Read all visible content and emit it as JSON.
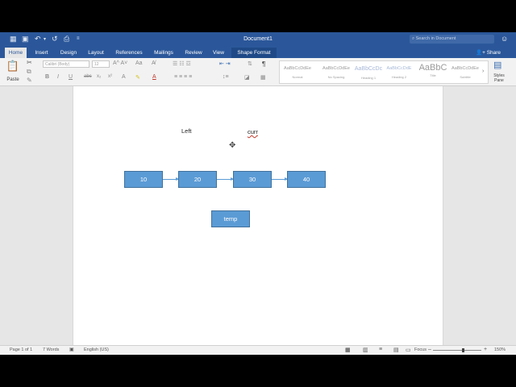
{
  "window": {
    "title": "Document1",
    "search_placeholder": "Search in Document",
    "qat": [
      "grid-icon",
      "save-icon",
      "undo-icon",
      "redo-icon",
      "print-icon",
      "customize-icon"
    ]
  },
  "tabs": [
    "Home",
    "Insert",
    "Design",
    "Layout",
    "References",
    "Mailings",
    "Review",
    "View",
    "Shape Format"
  ],
  "active_tab": "Home",
  "share_label": "Share",
  "ribbon": {
    "paste_label": "Paste",
    "font_name": "Calibri (Body)",
    "font_size": "12",
    "styles": [
      {
        "sample": "AaBbCcDdEe",
        "name": "Normal"
      },
      {
        "sample": "AaBbCcDdEe",
        "name": "No Spacing"
      },
      {
        "sample": "AaBbCcDc",
        "name": "Heading 1"
      },
      {
        "sample": "AaBbCcDdE",
        "name": "Heading 2"
      },
      {
        "sample": "AaBbC",
        "name": "Title"
      },
      {
        "sample": "AaBbCcDdEe",
        "name": "Subtitle"
      }
    ],
    "styles_pane_label": "Styles Pane"
  },
  "diagram": {
    "nodes": [
      "10",
      "20",
      "30",
      "40"
    ],
    "left_label": "Left",
    "curr_label": "curr",
    "temp_label": "temp"
  },
  "status": {
    "page": "Page 1 of 1",
    "words": "7 Words",
    "language": "English (US)",
    "focus": "Focus",
    "zoom": "150%",
    "zoom_level": 0.6
  }
}
